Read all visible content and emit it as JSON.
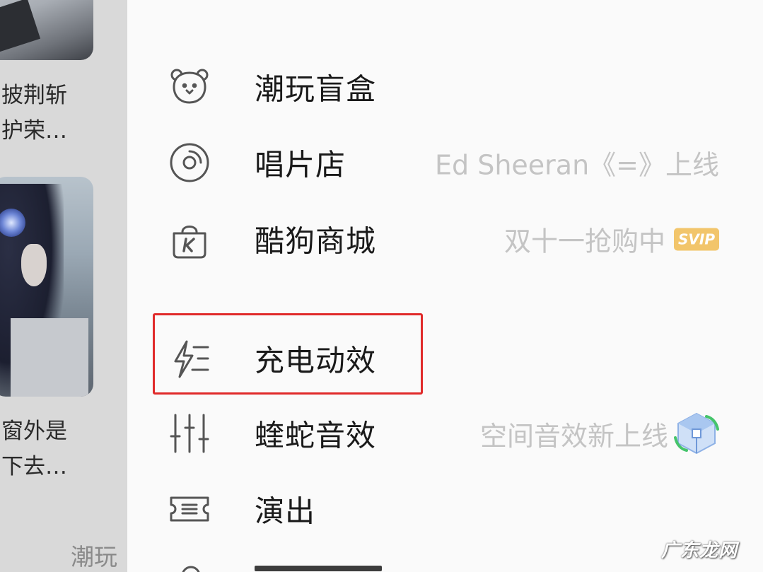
{
  "background": {
    "snippet_1_line_1": "披荆斩",
    "snippet_1_line_2": "护荣…",
    "snippet_2_line_1": "窗外是",
    "snippet_2_line_2": "下去…",
    "bottom_label": "潮玩"
  },
  "menu": {
    "items": [
      {
        "label": "潮玩盲盒",
        "subtitle": "",
        "icon": "bear-face-icon"
      },
      {
        "label": "唱片店",
        "subtitle": "Ed Sheeran《=》上线",
        "icon": "vinyl-record-icon"
      },
      {
        "label": "酷狗商城",
        "subtitle": "双十一抢购中",
        "badge": "SVIP",
        "icon": "shopping-bag-k-icon"
      },
      {
        "label": "充电动效",
        "subtitle": "",
        "icon": "lightning-charge-icon",
        "highlighted": true
      },
      {
        "label": "蝰蛇音效",
        "subtitle": "空间音效新上线",
        "icon": "equalizer-sliders-icon",
        "trailing_icon": "3d-cube-icon"
      },
      {
        "label": "演出",
        "subtitle": "",
        "icon": "ticket-icon"
      }
    ]
  },
  "watermark": "广东龙网",
  "colors": {
    "highlight_border": "#e02a2a",
    "svip_badge": "#f2c56b",
    "subtitle_text": "#c4c4c4"
  }
}
